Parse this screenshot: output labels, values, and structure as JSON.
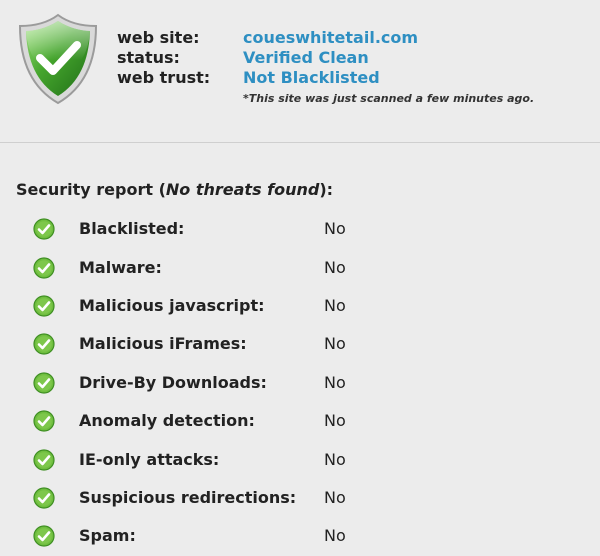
{
  "summary": {
    "website_label": "web site:",
    "website_value": "coueswhitetail.com",
    "status_label": "status:",
    "status_value": "Verified Clean",
    "trust_label": "web trust:",
    "trust_value": "Not Blacklisted",
    "scan_note": "*This site was just scanned a few minutes ago.",
    "shield_icon": "verified-shield-check-icon",
    "accent_color": "#2e8fc2"
  },
  "report": {
    "title_prefix": "Security report (",
    "title_emphasis": "No threats found",
    "title_suffix": "):",
    "status_icon": "green-check-circle-icon",
    "items": [
      {
        "label": "Blacklisted:",
        "value": "No"
      },
      {
        "label": "Malware:",
        "value": "No"
      },
      {
        "label": "Malicious javascript:",
        "value": "No"
      },
      {
        "label": "Malicious iFrames:",
        "value": "No"
      },
      {
        "label": "Drive-By Downloads:",
        "value": "No"
      },
      {
        "label": "Anomaly detection:",
        "value": "No"
      },
      {
        "label": "IE-only attacks:",
        "value": "No"
      },
      {
        "label": "Suspicious redirections:",
        "value": "No"
      },
      {
        "label": "Spam:",
        "value": "No"
      }
    ]
  }
}
